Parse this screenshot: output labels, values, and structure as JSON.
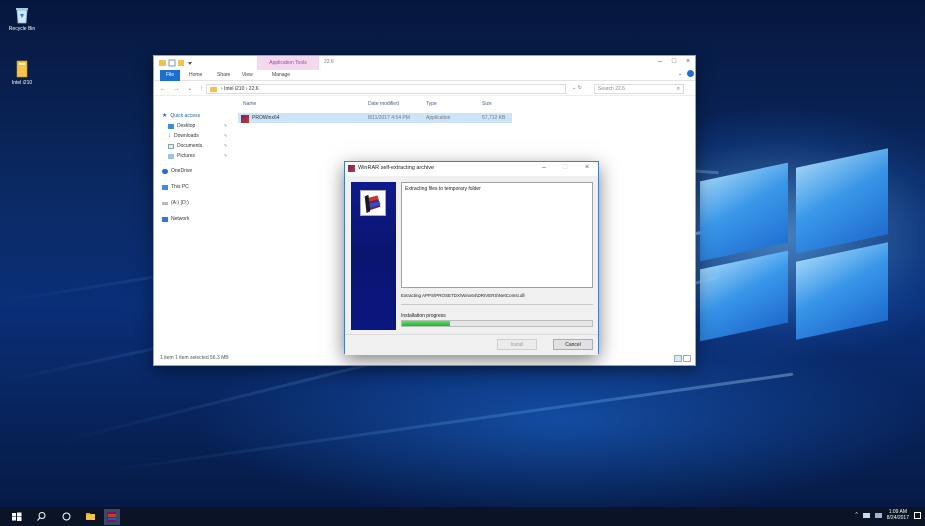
{
  "desktop": {
    "icons": [
      {
        "label": "Recycle Bin"
      },
      {
        "label": "Intel i210"
      }
    ]
  },
  "explorer": {
    "context_tab": "Application Tools",
    "title": "22.6",
    "ribbon_tabs": [
      "File",
      "Home",
      "Share",
      "View",
      "Manage"
    ],
    "address": {
      "path": "› Intel i210 › 22.6",
      "search_placeholder": "Search 22.6"
    },
    "nav": {
      "quick_access": "Quick access",
      "items": [
        "Desktop",
        "Downloads",
        "Documents",
        "Pictures"
      ],
      "onedrive": "OneDrive",
      "this_pc": "This PC",
      "drive": "(A:) (D:)",
      "network": "Network"
    },
    "columns": [
      "Name",
      "Date modified",
      "Type",
      "Size"
    ],
    "files": [
      {
        "name": "PROWinx64",
        "date": "8/11/2017 4:54 PM",
        "type": "Application",
        "size": "57,712 KB"
      }
    ],
    "status": "1 item    1 item selected  56.3 MB"
  },
  "sfx_dialog": {
    "title": "WinRAR self-extracting archive",
    "box_text": "Extracting files to temporary folder",
    "current_file": "Extracting APPS\\PROSETDX\\Winx64\\DRIVERS\\NetCoInst.dll",
    "progress_label": "Installation progress",
    "progress_fraction": 0.25,
    "buttons": {
      "install": "Install",
      "cancel": "Cancel"
    },
    "colors": {
      "progress": "#1fb62f",
      "sidebar": "#0e1a8c"
    }
  },
  "taskbar": {
    "time": "1:09 AM",
    "date": "8/24/2017",
    "icons": [
      "start-icon",
      "search-icon",
      "task-view-icon",
      "file-explorer-icon",
      "winrar-icon"
    ]
  }
}
